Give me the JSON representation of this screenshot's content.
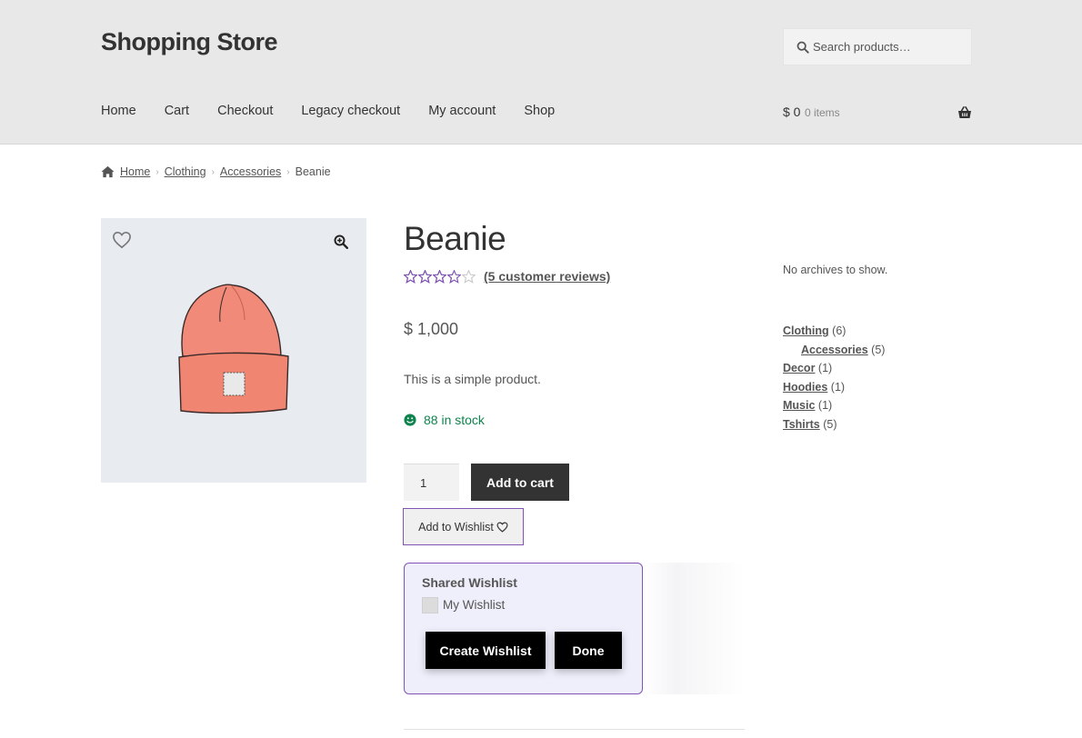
{
  "header": {
    "site_title": "Shopping Store",
    "search_placeholder": "Search products…",
    "nav": [
      "Home",
      "Cart",
      "Checkout",
      "Legacy checkout",
      "My account",
      "Shop"
    ],
    "cart_amount": "$ 0",
    "cart_count": "0 items"
  },
  "breadcrumb": {
    "home": "Home",
    "items": [
      "Clothing",
      "Accessories"
    ],
    "current": "Beanie"
  },
  "product": {
    "title": "Beanie",
    "rating": 3.4,
    "review_link": "(5 customer reviews)",
    "price": "$ 1,000",
    "short_description": "This is a simple product.",
    "stock": "88 in stock",
    "quantity": "1",
    "add_to_cart_label": "Add to cart",
    "add_to_wishlist_label": "Add to Wishlist"
  },
  "wishlist_popup": {
    "title": "Shared Wishlist",
    "option_label": "My Wishlist",
    "create_label": "Create Wishlist",
    "done_label": "Done"
  },
  "sidebar": {
    "archives_text": "No archives to show.",
    "categories": [
      {
        "name": "Clothing",
        "count": "(6)"
      },
      {
        "name": "Accessories",
        "count": "(5)"
      },
      {
        "name": "Decor",
        "count": "(1)"
      },
      {
        "name": "Hoodies",
        "count": "(1)"
      },
      {
        "name": "Music",
        "count": "(1)"
      },
      {
        "name": "Tshirts",
        "count": "(5)"
      }
    ]
  },
  "colors": {
    "header_bg": "#e8e8e8",
    "accent_purple": "#7f54b3",
    "stock_green": "#0f834d",
    "button_dark": "#333333"
  },
  "icons": [
    "search-icon",
    "basket-icon",
    "home-icon",
    "heart-icon",
    "zoom-icon",
    "star-icon",
    "smile-icon"
  ]
}
